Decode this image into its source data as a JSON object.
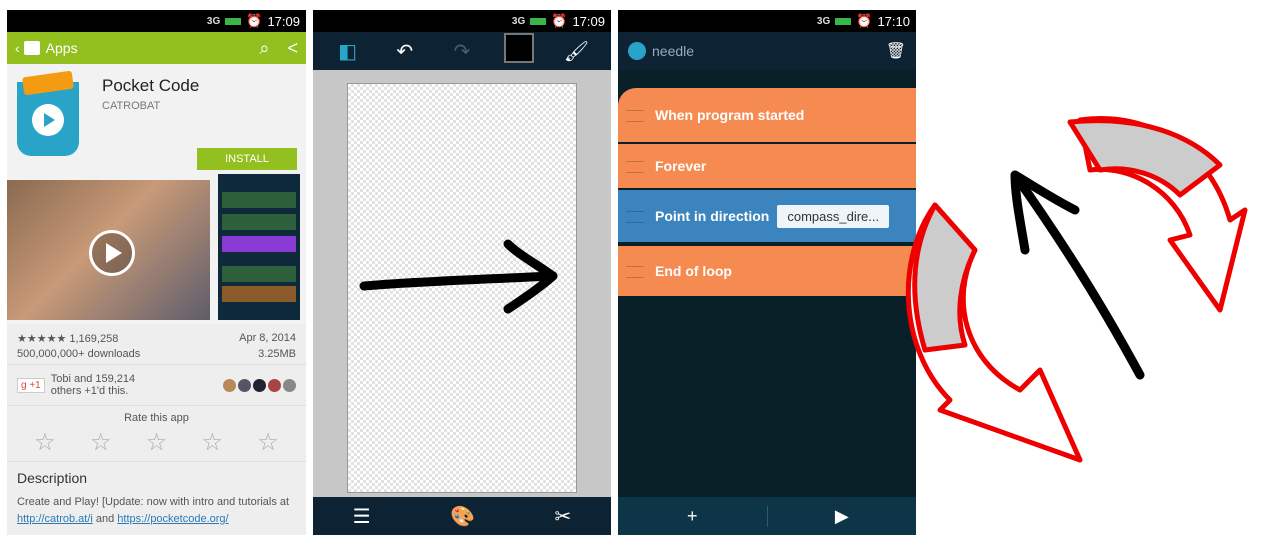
{
  "status": {
    "time1": "17:09",
    "time2": "17:09",
    "time3": "17:10",
    "network": "3G"
  },
  "store": {
    "section": "Apps",
    "app_name": "Pocket Code",
    "developer": "CATROBAT",
    "install_label": "INSTALL",
    "rating_stars": "★★★★★",
    "rating_count": "1,169,258",
    "date": "Apr 8, 2014",
    "downloads": "500,000,000+ downloads",
    "size": "3.25MB",
    "gplus_badge": "g +1",
    "plus_line1": "Tobi and 159,214",
    "plus_line2": "others +1'd this.",
    "rate_label": "Rate this app",
    "description_title": "Description",
    "description_prefix": "Create and Play! [Update: now with intro and tutorials at ",
    "link1": "http://catrob.at/i",
    "description_mid": " and ",
    "link2": "https://pocketcode.org/"
  },
  "paint": {
    "undo_icon": "undo-icon",
    "redo_icon": "redo-icon",
    "color": "#000000"
  },
  "script": {
    "title": "needle",
    "bricks": [
      {
        "label": "When program started",
        "color": "#f58b50"
      },
      {
        "label": "Forever",
        "color": "#f58b50"
      },
      {
        "label": "Point in direction",
        "value": "compass_dire...",
        "color": "#3b84bd"
      },
      {
        "label": "End of loop",
        "color": "#f58b50"
      }
    ],
    "add_label": "+",
    "play_label": "▶"
  }
}
